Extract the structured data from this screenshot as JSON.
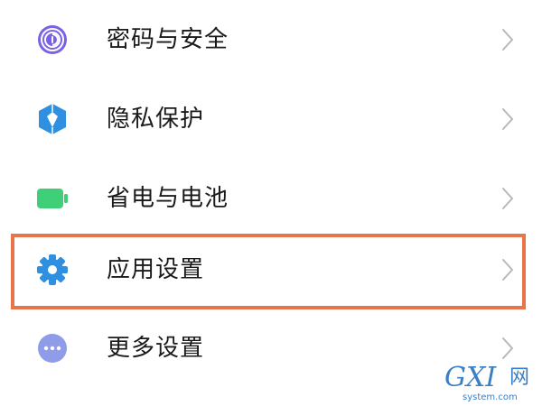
{
  "settings": {
    "items": [
      {
        "label": "密码与安全",
        "icon": "fingerprint-icon",
        "icon_color": "#7b61e8"
      },
      {
        "label": "隐私保护",
        "icon": "privacy-shield-icon",
        "icon_color": "#2f8fe0"
      },
      {
        "label": "省电与电池",
        "icon": "battery-icon",
        "icon_color": "#3ecf78"
      },
      {
        "label": "应用设置",
        "icon": "gear-icon",
        "icon_color": "#2f8fe0",
        "highlighted": true
      },
      {
        "label": "更多设置",
        "icon": "more-dots-icon",
        "icon_color": "#8f9ce8"
      }
    ],
    "chevron_icon": "chevron-right-icon",
    "chevron_color": "#b8b8b8",
    "highlight_color": "#e8744a"
  },
  "watermark": {
    "letters": "GXI",
    "chinese": "网",
    "url": "system.com"
  }
}
